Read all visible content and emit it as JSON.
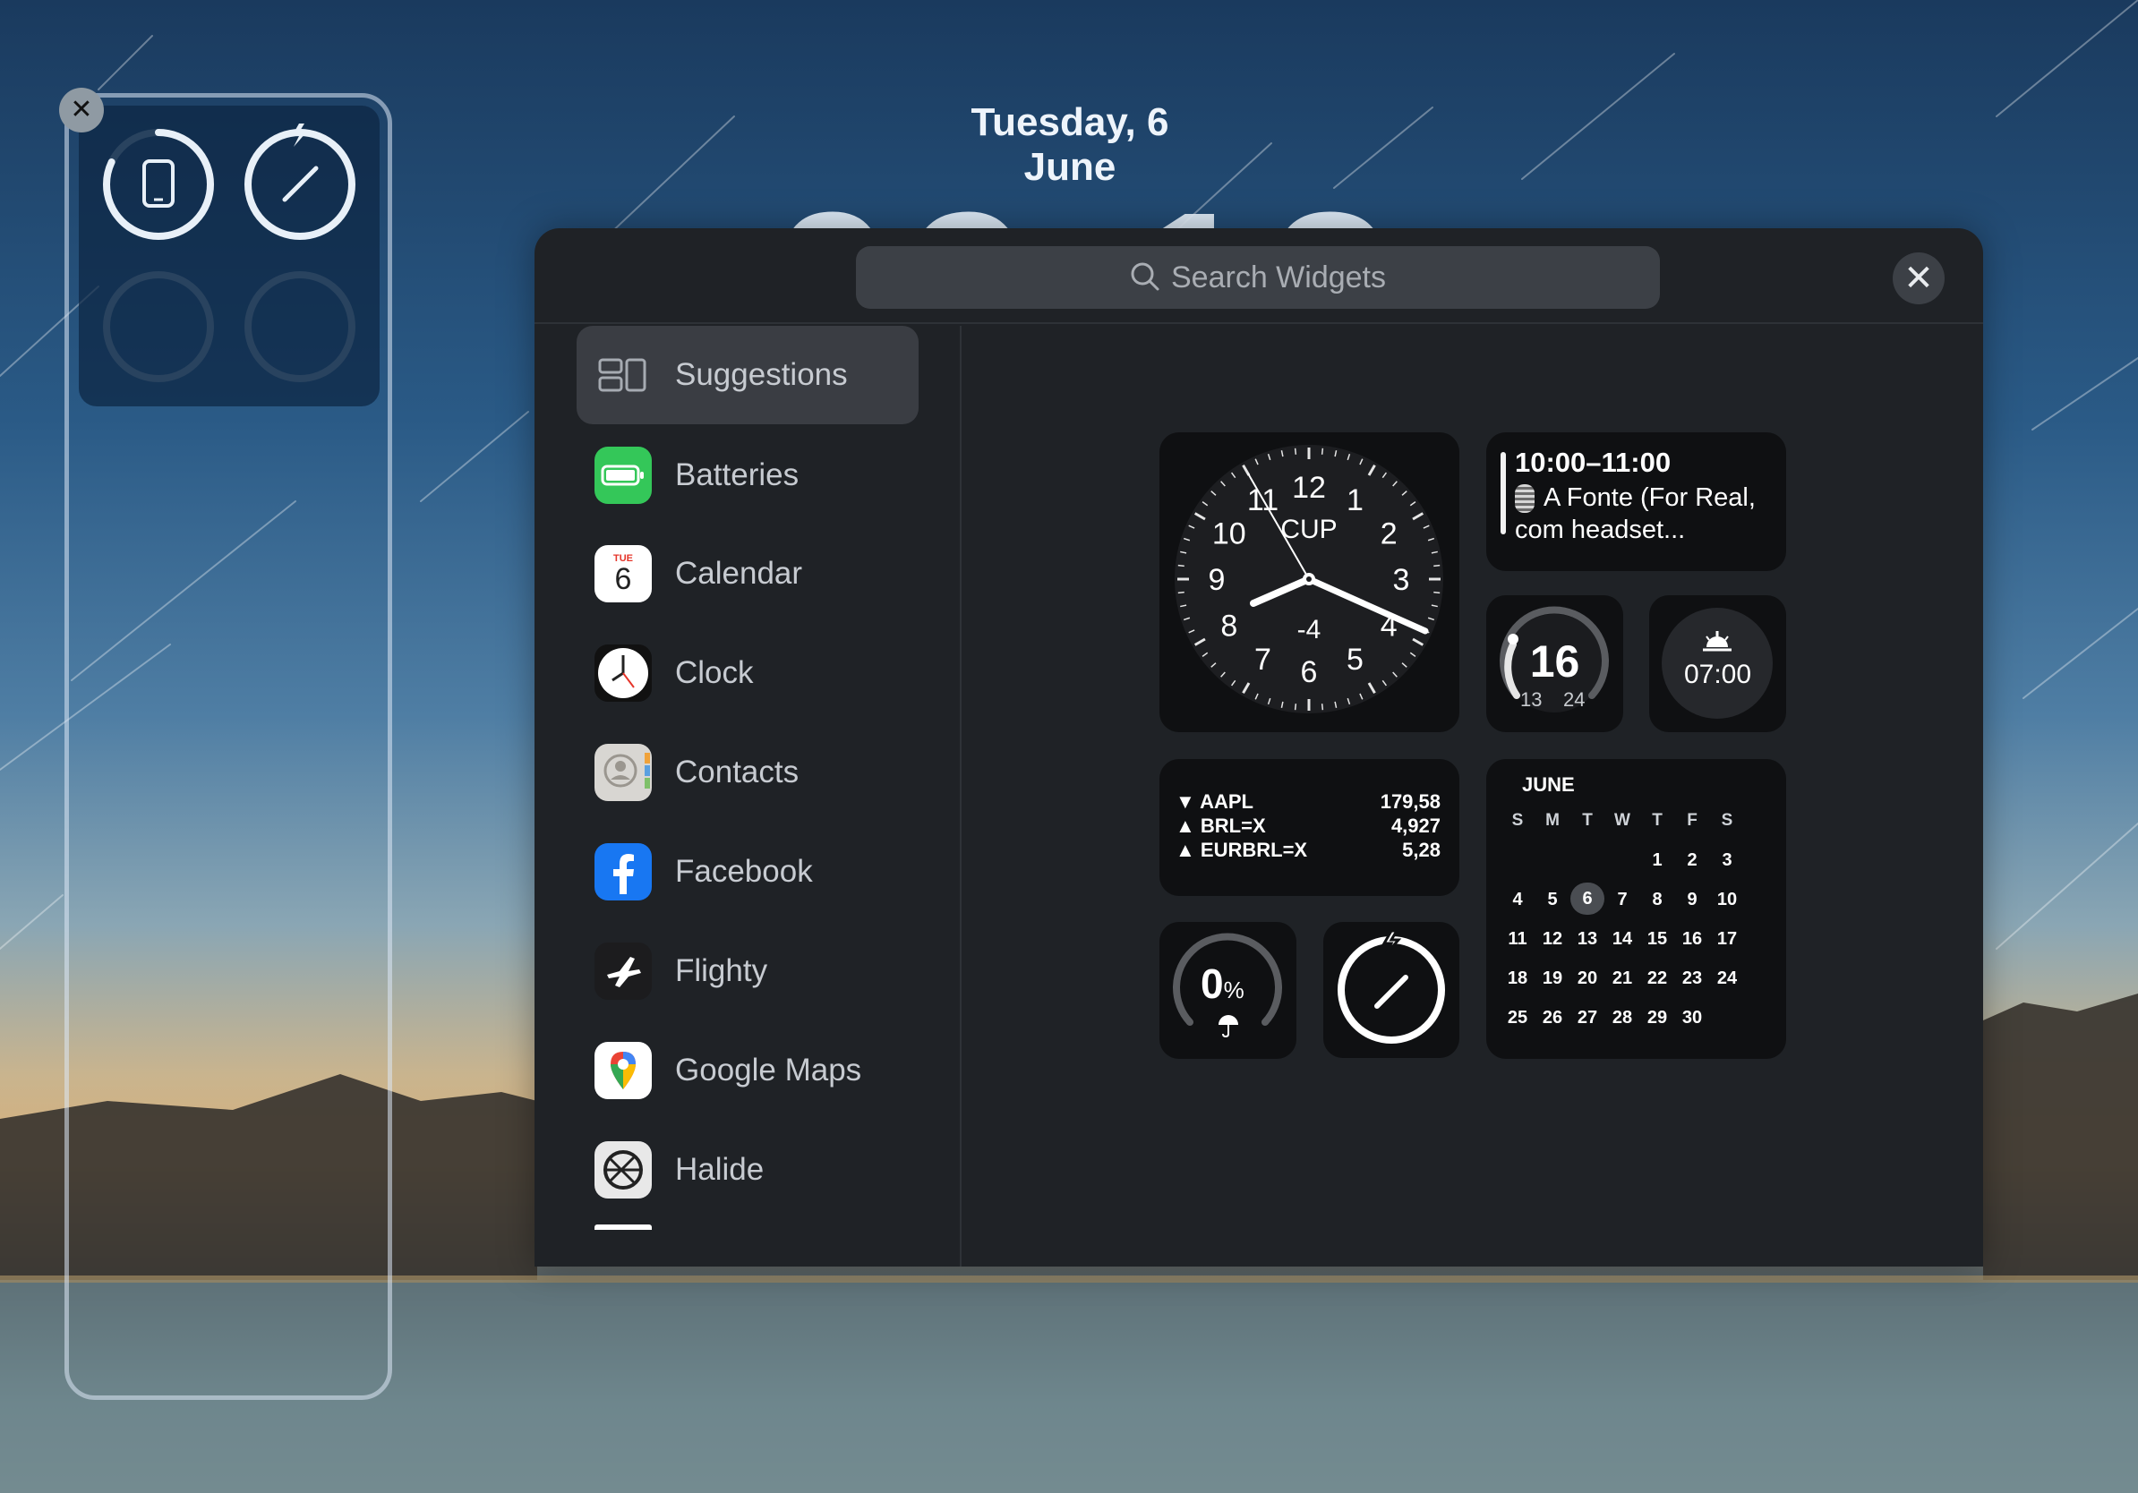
{
  "lock_screen": {
    "date": "Tuesday, 6 June",
    "time": "09:12"
  },
  "battery_widget": {
    "close_symbol": "✕",
    "devices": [
      {
        "icon": "ipad-icon",
        "level": 0.82
      },
      {
        "icon": "apple-pencil-icon",
        "level": 1.0,
        "charging": true
      },
      {
        "icon": "empty-slot",
        "level": 0
      },
      {
        "icon": "empty-slot",
        "level": 0
      }
    ]
  },
  "gallery": {
    "search_placeholder": "Search Widgets",
    "close_symbol": "✕",
    "sidebar": [
      {
        "label": "Suggestions",
        "icon": "suggestions-icon",
        "selected": true
      },
      {
        "label": "Batteries",
        "icon": "batteries-icon"
      },
      {
        "label": "Calendar",
        "icon": "calendar-icon",
        "icon_day": "TUE",
        "icon_date": "6"
      },
      {
        "label": "Clock",
        "icon": "clock-icon"
      },
      {
        "label": "Contacts",
        "icon": "contacts-icon"
      },
      {
        "label": "Facebook",
        "icon": "facebook-icon"
      },
      {
        "label": "Flighty",
        "icon": "flighty-icon"
      },
      {
        "label": "Google Maps",
        "icon": "google-maps-icon"
      },
      {
        "label": "Halide",
        "icon": "halide-icon"
      }
    ],
    "widgets": {
      "world_clock": {
        "city": "CUP",
        "offset": "-4",
        "numbers": [
          "12",
          "1",
          "2",
          "3",
          "4",
          "5",
          "6",
          "7",
          "8",
          "9",
          "10",
          "11"
        ]
      },
      "event": {
        "time": "10:00–11:00",
        "title": "A Fonte (For Real, com headset..."
      },
      "weather_gauge": {
        "temp": "16",
        "low": "13",
        "high": "24"
      },
      "alarm": {
        "time": "07:00",
        "icon": "sunrise-icon"
      },
      "stocks": [
        {
          "symbol": "AAPL",
          "dir": "▼",
          "value": "179,58"
        },
        {
          "symbol": "BRL=X",
          "dir": "▲",
          "value": "4,927"
        },
        {
          "symbol": "EURBRL=X",
          "dir": "▲",
          "value": "5,28"
        }
      ],
      "calendar": {
        "month": "JUNE",
        "weekdays": [
          "S",
          "M",
          "T",
          "W",
          "T",
          "F",
          "S"
        ],
        "weeks": [
          [
            "",
            "",
            "",
            "",
            "1",
            "2",
            "3"
          ],
          [
            "4",
            "5",
            "6",
            "7",
            "8",
            "9",
            "10"
          ],
          [
            "11",
            "12",
            "13",
            "14",
            "15",
            "16",
            "17"
          ],
          [
            "18",
            "19",
            "20",
            "21",
            "22",
            "23",
            "24"
          ],
          [
            "25",
            "26",
            "27",
            "28",
            "29",
            "30",
            ""
          ]
        ],
        "today": "6"
      },
      "rain": {
        "value": "0",
        "unit": "%",
        "icon": "umbrella-icon"
      },
      "pencil_battery": {
        "icon": "apple-pencil-icon",
        "level": 1.0
      }
    }
  }
}
